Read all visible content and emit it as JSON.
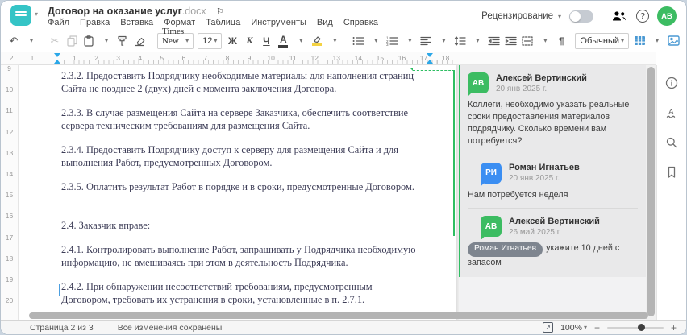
{
  "window": {
    "title": "Договор на оказание услуг",
    "title_ext": ".docx",
    "menus": [
      "Файл",
      "Правка",
      "Вставка",
      "Формат",
      "Таблица",
      "Инструменты",
      "Вид",
      "Справка"
    ],
    "review_label": "Рецензирование",
    "avatar_initials": "АВ"
  },
  "toolbar": {
    "font_name": "Times New ...",
    "font_size": "12",
    "bold_label": "Ж",
    "italic_label": "К",
    "underline_label": "Ч",
    "font_color_label": "А",
    "style_name": "Обычный",
    "paragraph_mark": "¶",
    "more_label": "⋯"
  },
  "icons": {
    "undo-icon": "↶",
    "cut-icon": "✂",
    "flag-icon": "⚐",
    "help-icon": "?",
    "minus": "−",
    "plus": "+",
    "fit-arrow": "↗"
  },
  "ruler": {
    "h_left": [
      "2",
      "1"
    ],
    "h_right": [
      "1",
      "2",
      "3",
      "4",
      "5",
      "6",
      "7",
      "8",
      "9",
      "10",
      "11",
      "12",
      "13",
      "14",
      "15",
      "16",
      "17",
      "18"
    ],
    "v": [
      "9",
      "10",
      "11",
      "12",
      "13",
      "14",
      "15",
      "16",
      "17",
      "18",
      "19",
      "20"
    ]
  },
  "document": {
    "paragraphs": [
      {
        "pre": "2.3.2. Предоставить Подрядчику необходимые материалы для наполнения страниц Сайта не ",
        "u": "позднее",
        "post": " 2 (двух) дней с момента заключения Договора.",
        "gap": "false"
      },
      {
        "pre": "2.3.3. В случае размещения Сайта на сервере Заказчика, обеспечить соответствие сервера техническим требованиям для размещения Сайта.",
        "u": "",
        "post": "",
        "gap": "false"
      },
      {
        "pre": "2.3.4. Предоставить Подрядчику доступ к серверу для размещения Сайта и для выполнения Работ, предусмотренных Договором.",
        "u": "",
        "post": "",
        "gap": "false"
      },
      {
        "pre": "2.3.5. Оплатить результат Работ в порядке и в сроки, предусмотренные Договором.",
        "u": "",
        "post": "",
        "gap": "false"
      },
      {
        "pre": "2.4. Заказчик вправе:",
        "u": "",
        "post": "",
        "gap": "true"
      },
      {
        "pre": "2.4.1. Контролировать выполнение Работ, запрашивать у Подрядчика необходимую информацию, не вмешиваясь при этом в деятельность Подрядчика.",
        "u": "",
        "post": "",
        "gap": "false"
      },
      {
        "pre": "2.4.2. При обнаружении несоответствий требованиям, предусмотренным Договором, требовать их устранения в сроки, установленные ",
        "u": "в",
        "post": " п. 2.7.1.",
        "gap": "false"
      }
    ]
  },
  "comments": {
    "items": [
      {
        "initials": "АВ",
        "color": "#3cbc62",
        "name": "Алексей Вертинский",
        "date": "20 янв 2025 г.",
        "mention": "",
        "text": "Коллеги, необходимо указать реальные сроки предоставления материалов подрядчику. Сколько времени вам потребуется?",
        "reply": "no"
      },
      {
        "initials": "РИ",
        "color": "#3b8ef2",
        "name": "Роман Игнатьев",
        "date": "20 янв 2025 г.",
        "mention": "",
        "text": "Нам потребуется неделя",
        "reply": "yes"
      },
      {
        "initials": "АВ",
        "color": "#3cbc62",
        "name": "Алексей Вертинский",
        "date": "26 май 2025 г.",
        "mention": "Роман Игнатьев",
        "text": "укажите 10 дней с запасом",
        "reply": "yes"
      }
    ]
  },
  "statusbar": {
    "page_indicator": "Страница 2 из 3",
    "save_status": "Все изменения сохранены",
    "zoom_level": "100%"
  },
  "colors": {
    "accent_teal": "#35c4c6",
    "comment_green": "#3cbc62",
    "reply_blue": "#3b8ef2",
    "toolbar_blue": "#4a99d3",
    "anchor_green": "#2fbe63"
  }
}
